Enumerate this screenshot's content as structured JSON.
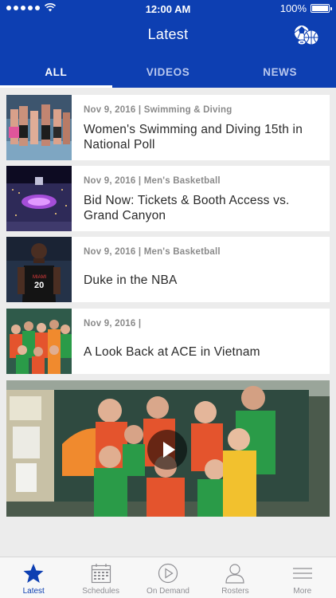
{
  "status_bar": {
    "time": "12:00 AM",
    "battery": "100%"
  },
  "header": {
    "title": "Latest",
    "sports_icon": "sports-balls-icon"
  },
  "tabs": [
    {
      "label": "ALL",
      "active": true
    },
    {
      "label": "VIDEOS",
      "active": false
    },
    {
      "label": "NEWS",
      "active": false
    }
  ],
  "feed": [
    {
      "meta": "Nov 9, 2016 | Swimming & Diving",
      "title": "Women's Swimming and Diving 15th in National Poll"
    },
    {
      "meta": "Nov 9, 2016 | Men's Basketball",
      "title": "Bid Now: Tickets & Booth Access vs. Grand Canyon"
    },
    {
      "meta": "Nov 9, 2016 | Men's Basketball",
      "title": "Duke in the NBA"
    },
    {
      "meta": "Nov 9, 2016 |",
      "title": "A Look Back at ACE in Vietnam"
    }
  ],
  "video": {
    "play_icon": "play-icon"
  },
  "tabbar": [
    {
      "label": "Latest",
      "icon": "star-icon",
      "active": true
    },
    {
      "label": "Schedules",
      "icon": "calendar-icon",
      "active": false
    },
    {
      "label": "On Demand",
      "icon": "play-circle-icon",
      "active": false
    },
    {
      "label": "Rosters",
      "icon": "person-icon",
      "active": false
    },
    {
      "label": "More",
      "icon": "menu-lines-icon",
      "active": false
    }
  ],
  "colors": {
    "brand_blue": "#0d3fb2",
    "tab_inactive": "#8e8e93"
  }
}
